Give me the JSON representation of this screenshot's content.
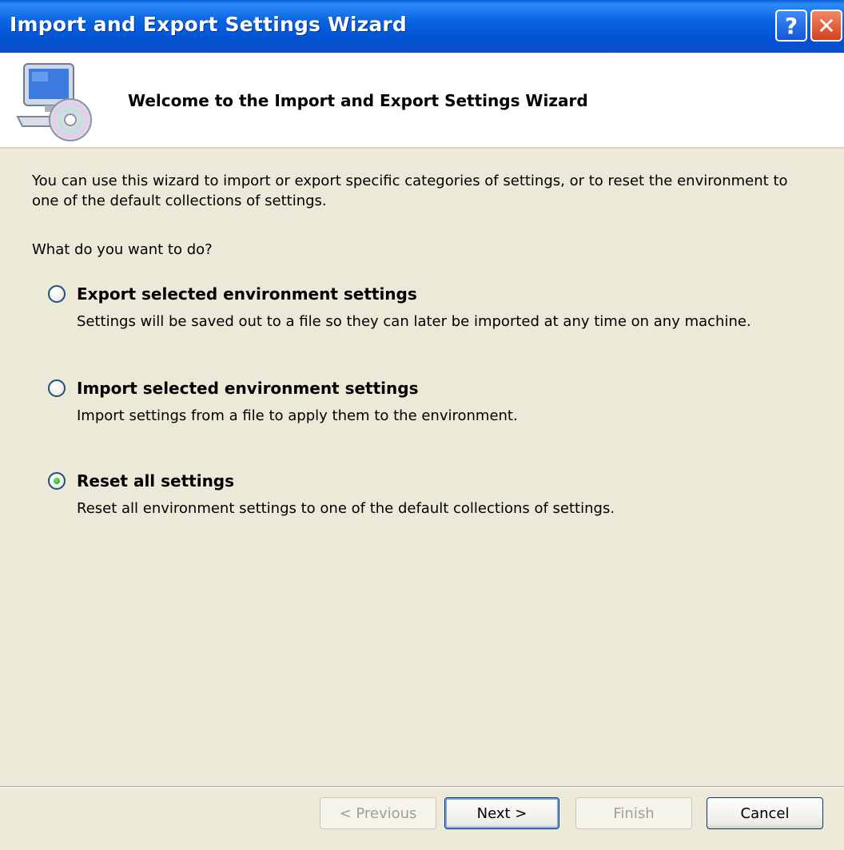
{
  "window": {
    "title": "Import and Export Settings Wizard",
    "help_glyph": "?",
    "close_glyph": "✕"
  },
  "header": {
    "heading": "Welcome to the Import and Export Settings Wizard",
    "icon": "computer-cd-icon"
  },
  "body": {
    "intro": "You can use this wizard to import or export specific categories of settings, or to reset the environment to one of the default collections of settings.",
    "question": "What do you want to do?",
    "options": [
      {
        "label": "Export selected environment settings",
        "description": "Settings will be saved out to a file so they can later be imported at any time on any machine.",
        "selected": false
      },
      {
        "label": "Import selected environment settings",
        "description": "Import settings from a file to apply them to the environment.",
        "selected": false
      },
      {
        "label": "Reset all settings",
        "description": "Reset all environment settings to one of the default collections of settings.",
        "selected": true
      }
    ]
  },
  "footer": {
    "previous_label": "< Previous",
    "next_label": "Next >",
    "finish_label": "Finish",
    "cancel_label": "Cancel"
  },
  "colors": {
    "title_bar": "#0a5fd8",
    "dialog_face": "#ece9d8",
    "close_button": "#d4401c",
    "radio_selected": "#1a9a1a"
  }
}
